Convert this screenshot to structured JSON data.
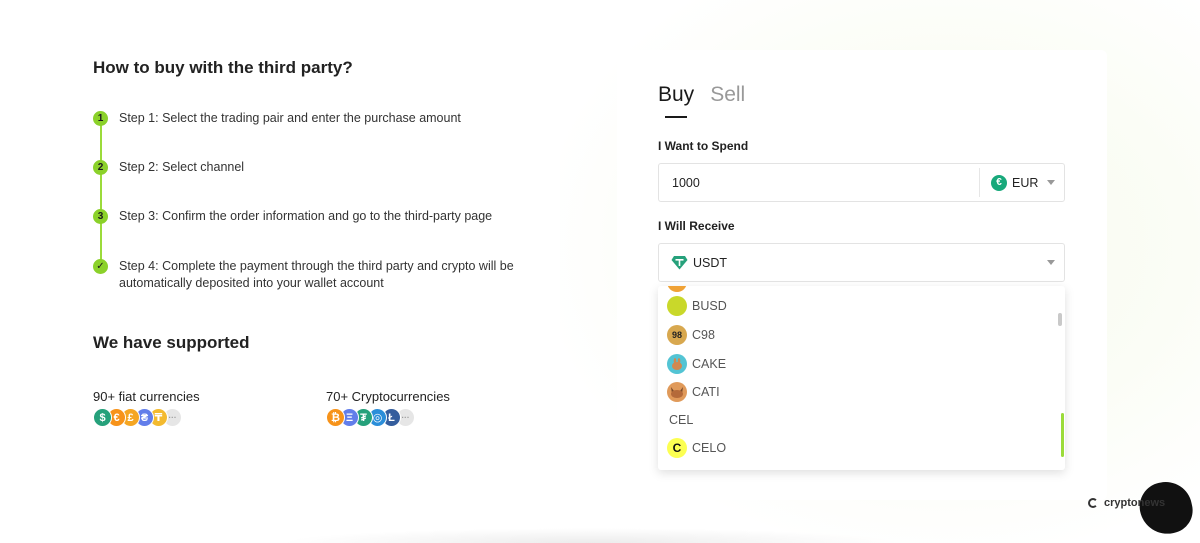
{
  "guide": {
    "title": "How to buy with the third party?",
    "steps": [
      {
        "marker": "1",
        "text": "Step 1: Select the trading pair and enter the purchase amount"
      },
      {
        "marker": "2",
        "text": "Step 2: Select channel"
      },
      {
        "marker": "3",
        "text": "Step 3: Confirm the order information and go to the third-party page"
      },
      {
        "marker": "✓",
        "text": "Step 4: Complete the payment through the third party and crypto will be automatically deposited into your wallet account"
      }
    ]
  },
  "supported": {
    "title": "We have supported",
    "fiat": {
      "label": "90+ fiat currencies",
      "icons": [
        {
          "glyph": "$",
          "color": "#26a17b"
        },
        {
          "glyph": "€",
          "color": "#f7931a"
        },
        {
          "glyph": "£",
          "color": "#f5a623"
        },
        {
          "glyph": "₴",
          "color": "#627eea"
        },
        {
          "glyph": "₸",
          "color": "#f3ba2f"
        },
        {
          "glyph": "···",
          "color": "#e6e6e6"
        }
      ]
    },
    "crypto": {
      "label": "70+ Cryptocurrencies",
      "icons": [
        {
          "glyph": "₿",
          "color": "#f7931a"
        },
        {
          "glyph": "Ξ",
          "color": "#627eea"
        },
        {
          "glyph": "₮",
          "color": "#26a17b"
        },
        {
          "glyph": "◎",
          "color": "#2b8ed9"
        },
        {
          "glyph": "Ł",
          "color": "#345d9d"
        },
        {
          "glyph": "···",
          "color": "#e6e6e6"
        }
      ]
    }
  },
  "trade": {
    "tabs": [
      {
        "label": "Buy",
        "active": true
      },
      {
        "label": "Sell",
        "active": false
      }
    ],
    "spend_label": "I Want to Spend",
    "spend_value": "1000",
    "spend_currency": "EUR",
    "receive_label": "I Will Receive",
    "receive_currency": "USDT",
    "dropdown_items": [
      {
        "label": "BUSD",
        "icon": "busd-icon",
        "color": "#c9d82a",
        "glyph": ""
      },
      {
        "label": "C98",
        "icon": "c98-icon",
        "color": "#d8a84f",
        "glyph": "98"
      },
      {
        "label": "CAKE",
        "icon": "cake-icon",
        "color": "#53c4d4",
        "glyph": "🐰"
      },
      {
        "label": "CATI",
        "icon": "cati-icon",
        "color": "#e09a5a",
        "glyph": "🐱"
      },
      {
        "label": "CEL",
        "icon": "",
        "color": "",
        "glyph": ""
      },
      {
        "label": "CELO",
        "icon": "celo-icon",
        "color": "#fcff52",
        "glyph": "C"
      }
    ]
  },
  "watermark": {
    "text": "cryptonews"
  }
}
